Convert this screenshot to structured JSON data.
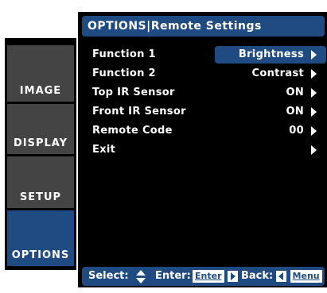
{
  "colors": {
    "accent": "#1f4b82",
    "tab_inactive": "#444444",
    "background": "#000000"
  },
  "header": {
    "title": "OPTIONS|Remote Settings"
  },
  "sidebar": {
    "tabs": [
      {
        "label": "IMAGE",
        "active": false
      },
      {
        "label": "DISPLAY",
        "active": false
      },
      {
        "label": "SETUP",
        "active": false
      },
      {
        "label": "OPTIONS",
        "active": true
      }
    ]
  },
  "menu": {
    "items": [
      {
        "label": "Function 1",
        "value": "Brightness",
        "selected": true,
        "icon": "chevron-right-icon"
      },
      {
        "label": "Function 2",
        "value": "Contrast",
        "selected": false,
        "icon": "chevron-right-icon"
      },
      {
        "label": "Top IR Sensor",
        "value": "ON",
        "selected": false,
        "icon": "chevron-right-icon"
      },
      {
        "label": "Front IR Sensor",
        "value": "ON",
        "selected": false,
        "icon": "chevron-right-icon"
      },
      {
        "label": "Remote Code",
        "value": "00",
        "selected": false,
        "icon": "chevron-right-icon"
      },
      {
        "label": "Exit",
        "value": "",
        "selected": false,
        "icon": "chevron-right-icon"
      }
    ]
  },
  "footer": {
    "select_label": "Select:",
    "enter_label": "Enter:",
    "enter_key": "Enter",
    "back_label": "Back:",
    "menu_key": "Menu"
  }
}
